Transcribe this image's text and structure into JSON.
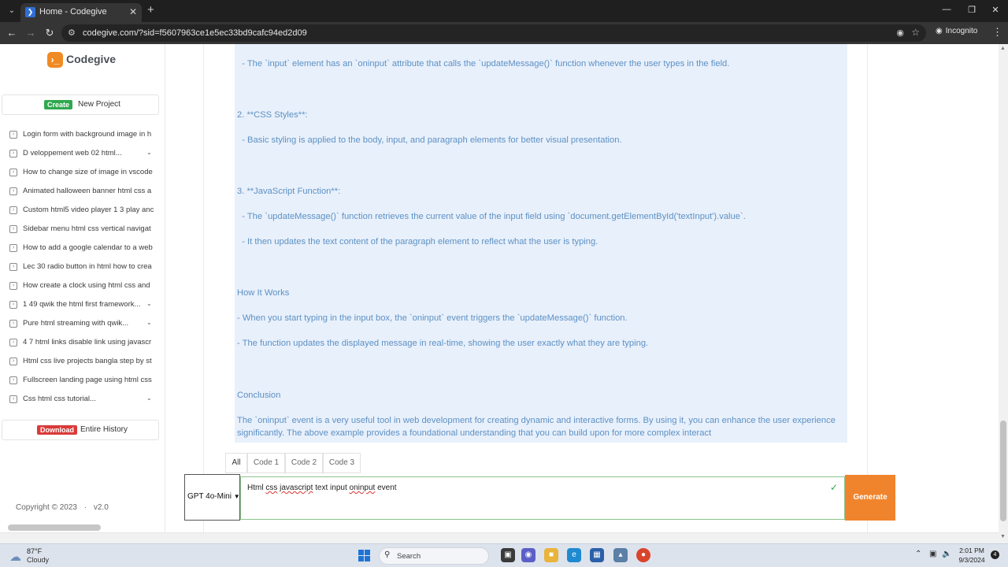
{
  "browser": {
    "tab_title": "Home - Codegive",
    "url": "codegive.com/?sid=f5607963ce1e5ec33bd9cafc94ed2d09",
    "incognito_label": "Incognito"
  },
  "sidebar": {
    "logo_text": "Codegive",
    "new_project": {
      "badge": "Create",
      "label": "New Project"
    },
    "history": [
      {
        "label": "Login form with background image in h",
        "has_chevron": false
      },
      {
        "label": "D veloppement web 02 html...",
        "has_chevron": true
      },
      {
        "label": "How to change size of image in vscode",
        "has_chevron": false
      },
      {
        "label": "Animated halloween banner html css a",
        "has_chevron": false
      },
      {
        "label": "Custom html5 video player 1 3 play anc",
        "has_chevron": false
      },
      {
        "label": "Sidebar menu html css vertical navigat",
        "has_chevron": false
      },
      {
        "label": "How to add a google calendar to a web",
        "has_chevron": false
      },
      {
        "label": "Lec 30 radio button in html how to crea",
        "has_chevron": false
      },
      {
        "label": "How create a clock using html css and",
        "has_chevron": false
      },
      {
        "label": "1 49 qwik the html first framework...",
        "has_chevron": true
      },
      {
        "label": "Pure html streaming with qwik...",
        "has_chevron": true
      },
      {
        "label": "4 7 html links disable link using javascr",
        "has_chevron": false
      },
      {
        "label": "Html css live projects bangla step by st",
        "has_chevron": false
      },
      {
        "label": "Fullscreen landing page using html css",
        "has_chevron": false
      },
      {
        "label": "Css html css tutorial...",
        "has_chevron": true
      }
    ],
    "download": {
      "badge": "Download",
      "label": "Entire History"
    },
    "copyright": "Copyright © 2023",
    "separator": "·",
    "version": "v2.0"
  },
  "response": {
    "lines": [
      "  - The `input` element has an `oninput` attribute that calls the `updateMessage()` function whenever the user types in the field.",
      "2. **CSS Styles**:",
      "  - Basic styling is applied to the body, input, and paragraph elements for better visual presentation.",
      "3. **JavaScript Function**:",
      "  - The `updateMessage()` function retrieves the current value of the input field using `document.getElementById('textInput').value`.",
      "  - It then updates the text content of the paragraph element to reflect what the user is typing.",
      "How It Works",
      "- When you start typing in the input box, the `oninput` event triggers the `updateMessage()` function.",
      "- The function updates the displayed message in real-time, showing the user exactly what they are typing.",
      "Conclusion",
      "The `oninput` event is a very useful tool in web development for creating dynamic and interactive forms. By using it, you can enhance the user experience significantly. The above example provides a foundational understanding that you can build upon for more complex interact"
    ]
  },
  "code_tabs": [
    "All",
    "Code 1",
    "Code 2",
    "Code 3"
  ],
  "prompt": {
    "model": "GPT 4o-Mini",
    "text_parts": [
      {
        "text": "Html ",
        "spell": false
      },
      {
        "text": "css",
        "spell": true
      },
      {
        "text": " ",
        "spell": false
      },
      {
        "text": "javascript",
        "spell": true
      },
      {
        "text": " text input ",
        "spell": false
      },
      {
        "text": "oninput",
        "spell": true
      },
      {
        "text": " event",
        "spell": false
      }
    ],
    "generate_label": "Generate"
  },
  "taskbar": {
    "weather_temp": "87°F",
    "weather_desc": "Cloudy",
    "search_label": "Search",
    "time": "2:01 PM",
    "date": "9/3/2024",
    "notification_count": "4"
  },
  "colors": {
    "accent": "#f0842c",
    "create_badge": "#2fa84f",
    "download_badge": "#d93a3a",
    "response_bg": "#e8f0fb",
    "response_text": "#5d91c4"
  }
}
